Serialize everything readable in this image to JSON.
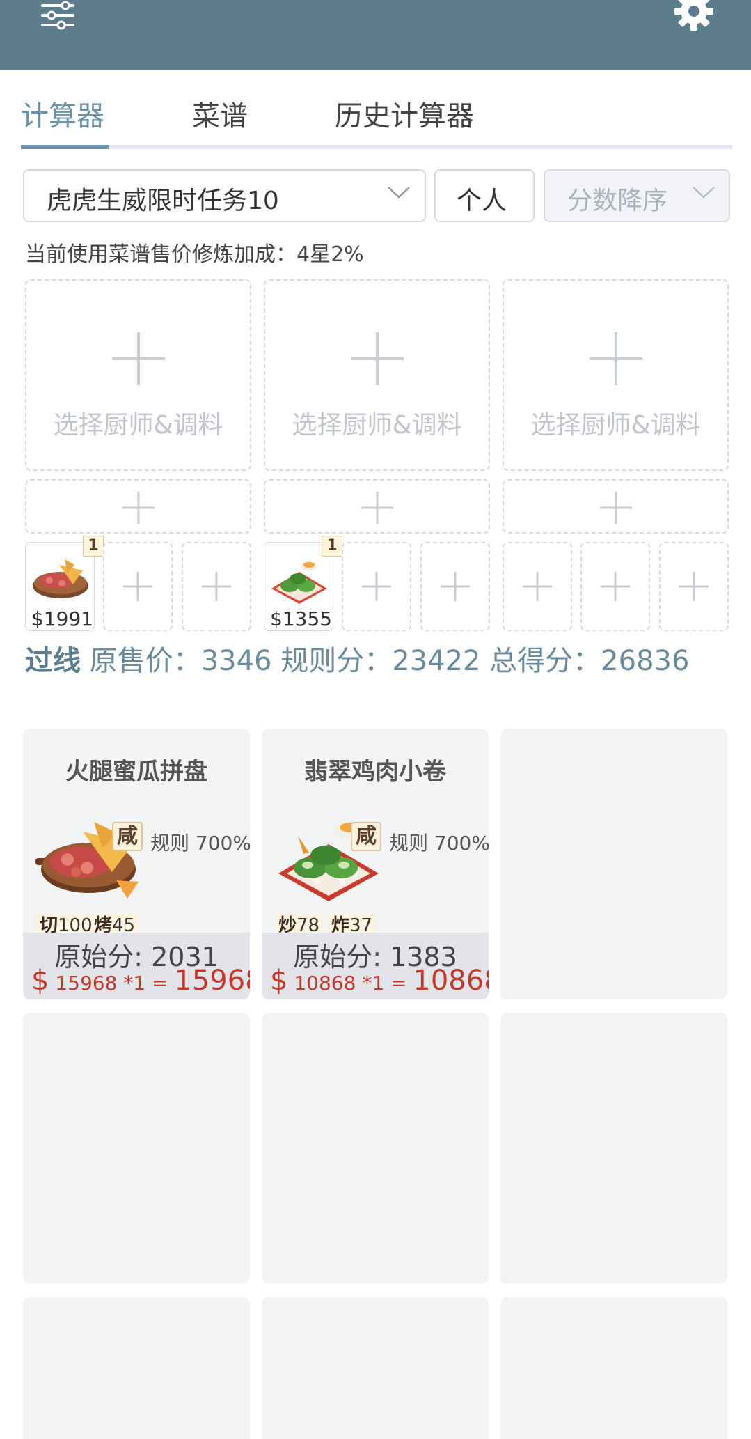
{
  "tabs": [
    "计算器",
    "菜谱",
    "历史计算器"
  ],
  "filters": {
    "task": "虎虎生威限时任务10",
    "person": "个人",
    "sort_placeholder": "分数降序"
  },
  "bonus_text": "当前使用菜谱售价修炼加成：4星2%",
  "chef_slot_label": "选择厨师&调料",
  "dish_slots": [
    {
      "price": "$1991",
      "count": "1"
    },
    {
      "price": "$1355",
      "count": "1"
    }
  ],
  "summary": {
    "pass": "过线",
    "rest": " 原售价：3346 规则分：23422 总得分：26836"
  },
  "cards": [
    {
      "name": "火腿蜜瓜拼盘",
      "tag": "咸",
      "rule": "规则 700%",
      "skill1_name": "切",
      "skill1_val": "100",
      "skill2_name": "烤",
      "skill2_val": "45",
      "stars": "★★★★",
      "orig": "原始分: 2031",
      "cur": "$",
      "formula": " 15968 *1 = ",
      "total": "15968"
    },
    {
      "name": "翡翠鸡肉小卷",
      "tag": "咸",
      "rule": "规则 700%",
      "skill1_name": "炒",
      "skill1_val": "78",
      "skill2_name": "炸",
      "skill2_val": "37",
      "stars": "★★★★",
      "orig": "原始分: 1383",
      "cur": "$",
      "formula": " 10868 *1 = ",
      "total": "10868"
    }
  ],
  "colors": {
    "header": "#5e7d8c",
    "accent": "#6a92a8",
    "price_red": "#c0392b"
  }
}
